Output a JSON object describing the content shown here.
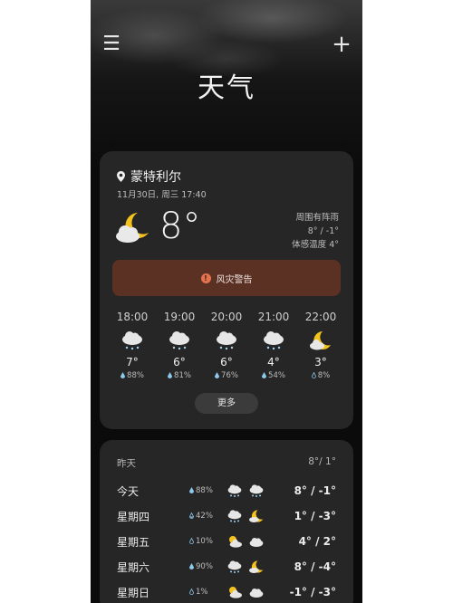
{
  "header": {
    "title": "天气",
    "menu_icon": "menu-icon",
    "add_icon": "plus-icon"
  },
  "current": {
    "location": "蒙特利尔",
    "datetime": "11月30日, 周三 17:40",
    "temperature": "8°",
    "condition": "周围有阵雨",
    "high_low": "8° / -1°",
    "feels_like": "体感温度 4°",
    "icon": "cloudy-night-icon"
  },
  "alert": {
    "label": "风灾警告",
    "color": "#5b3124"
  },
  "hourly": [
    {
      "time": "18:00",
      "icon": "snow-cloud-icon",
      "temp": "7°",
      "precip": "88%"
    },
    {
      "time": "19:00",
      "icon": "snow-cloud-icon",
      "temp": "6°",
      "precip": "81%"
    },
    {
      "time": "20:00",
      "icon": "snow-cloud-icon",
      "temp": "6°",
      "precip": "76%"
    },
    {
      "time": "21:00",
      "icon": "snow-cloud-icon",
      "temp": "4°",
      "precip": "54%"
    },
    {
      "time": "22:00",
      "icon": "partly-cloudy-night-icon",
      "temp": "3°",
      "precip": "8%"
    }
  ],
  "more_label": "更多",
  "daily": {
    "yesterday_label": "昨天",
    "yesterday_range": "8°/ 1°",
    "rows": [
      {
        "day": "今天",
        "precip": "88%",
        "icons": [
          "snow-cloud-icon",
          "snow-cloud-icon"
        ],
        "range": "8° / -1°"
      },
      {
        "day": "星期四",
        "precip": "42%",
        "icons": [
          "snow-cloud-icon",
          "moon-icon"
        ],
        "range": "1° / -3°"
      },
      {
        "day": "星期五",
        "precip": "10%",
        "icons": [
          "partly-sunny-icon",
          "cloud-icon"
        ],
        "range": "4° / 2°"
      },
      {
        "day": "星期六",
        "precip": "90%",
        "icons": [
          "snow-cloud-icon",
          "moon-icon"
        ],
        "range": "8° / -4°"
      },
      {
        "day": "星期日",
        "precip": "1%",
        "icons": [
          "partly-sunny-icon",
          "cloud-icon"
        ],
        "range": "-1° / -3°"
      }
    ]
  }
}
